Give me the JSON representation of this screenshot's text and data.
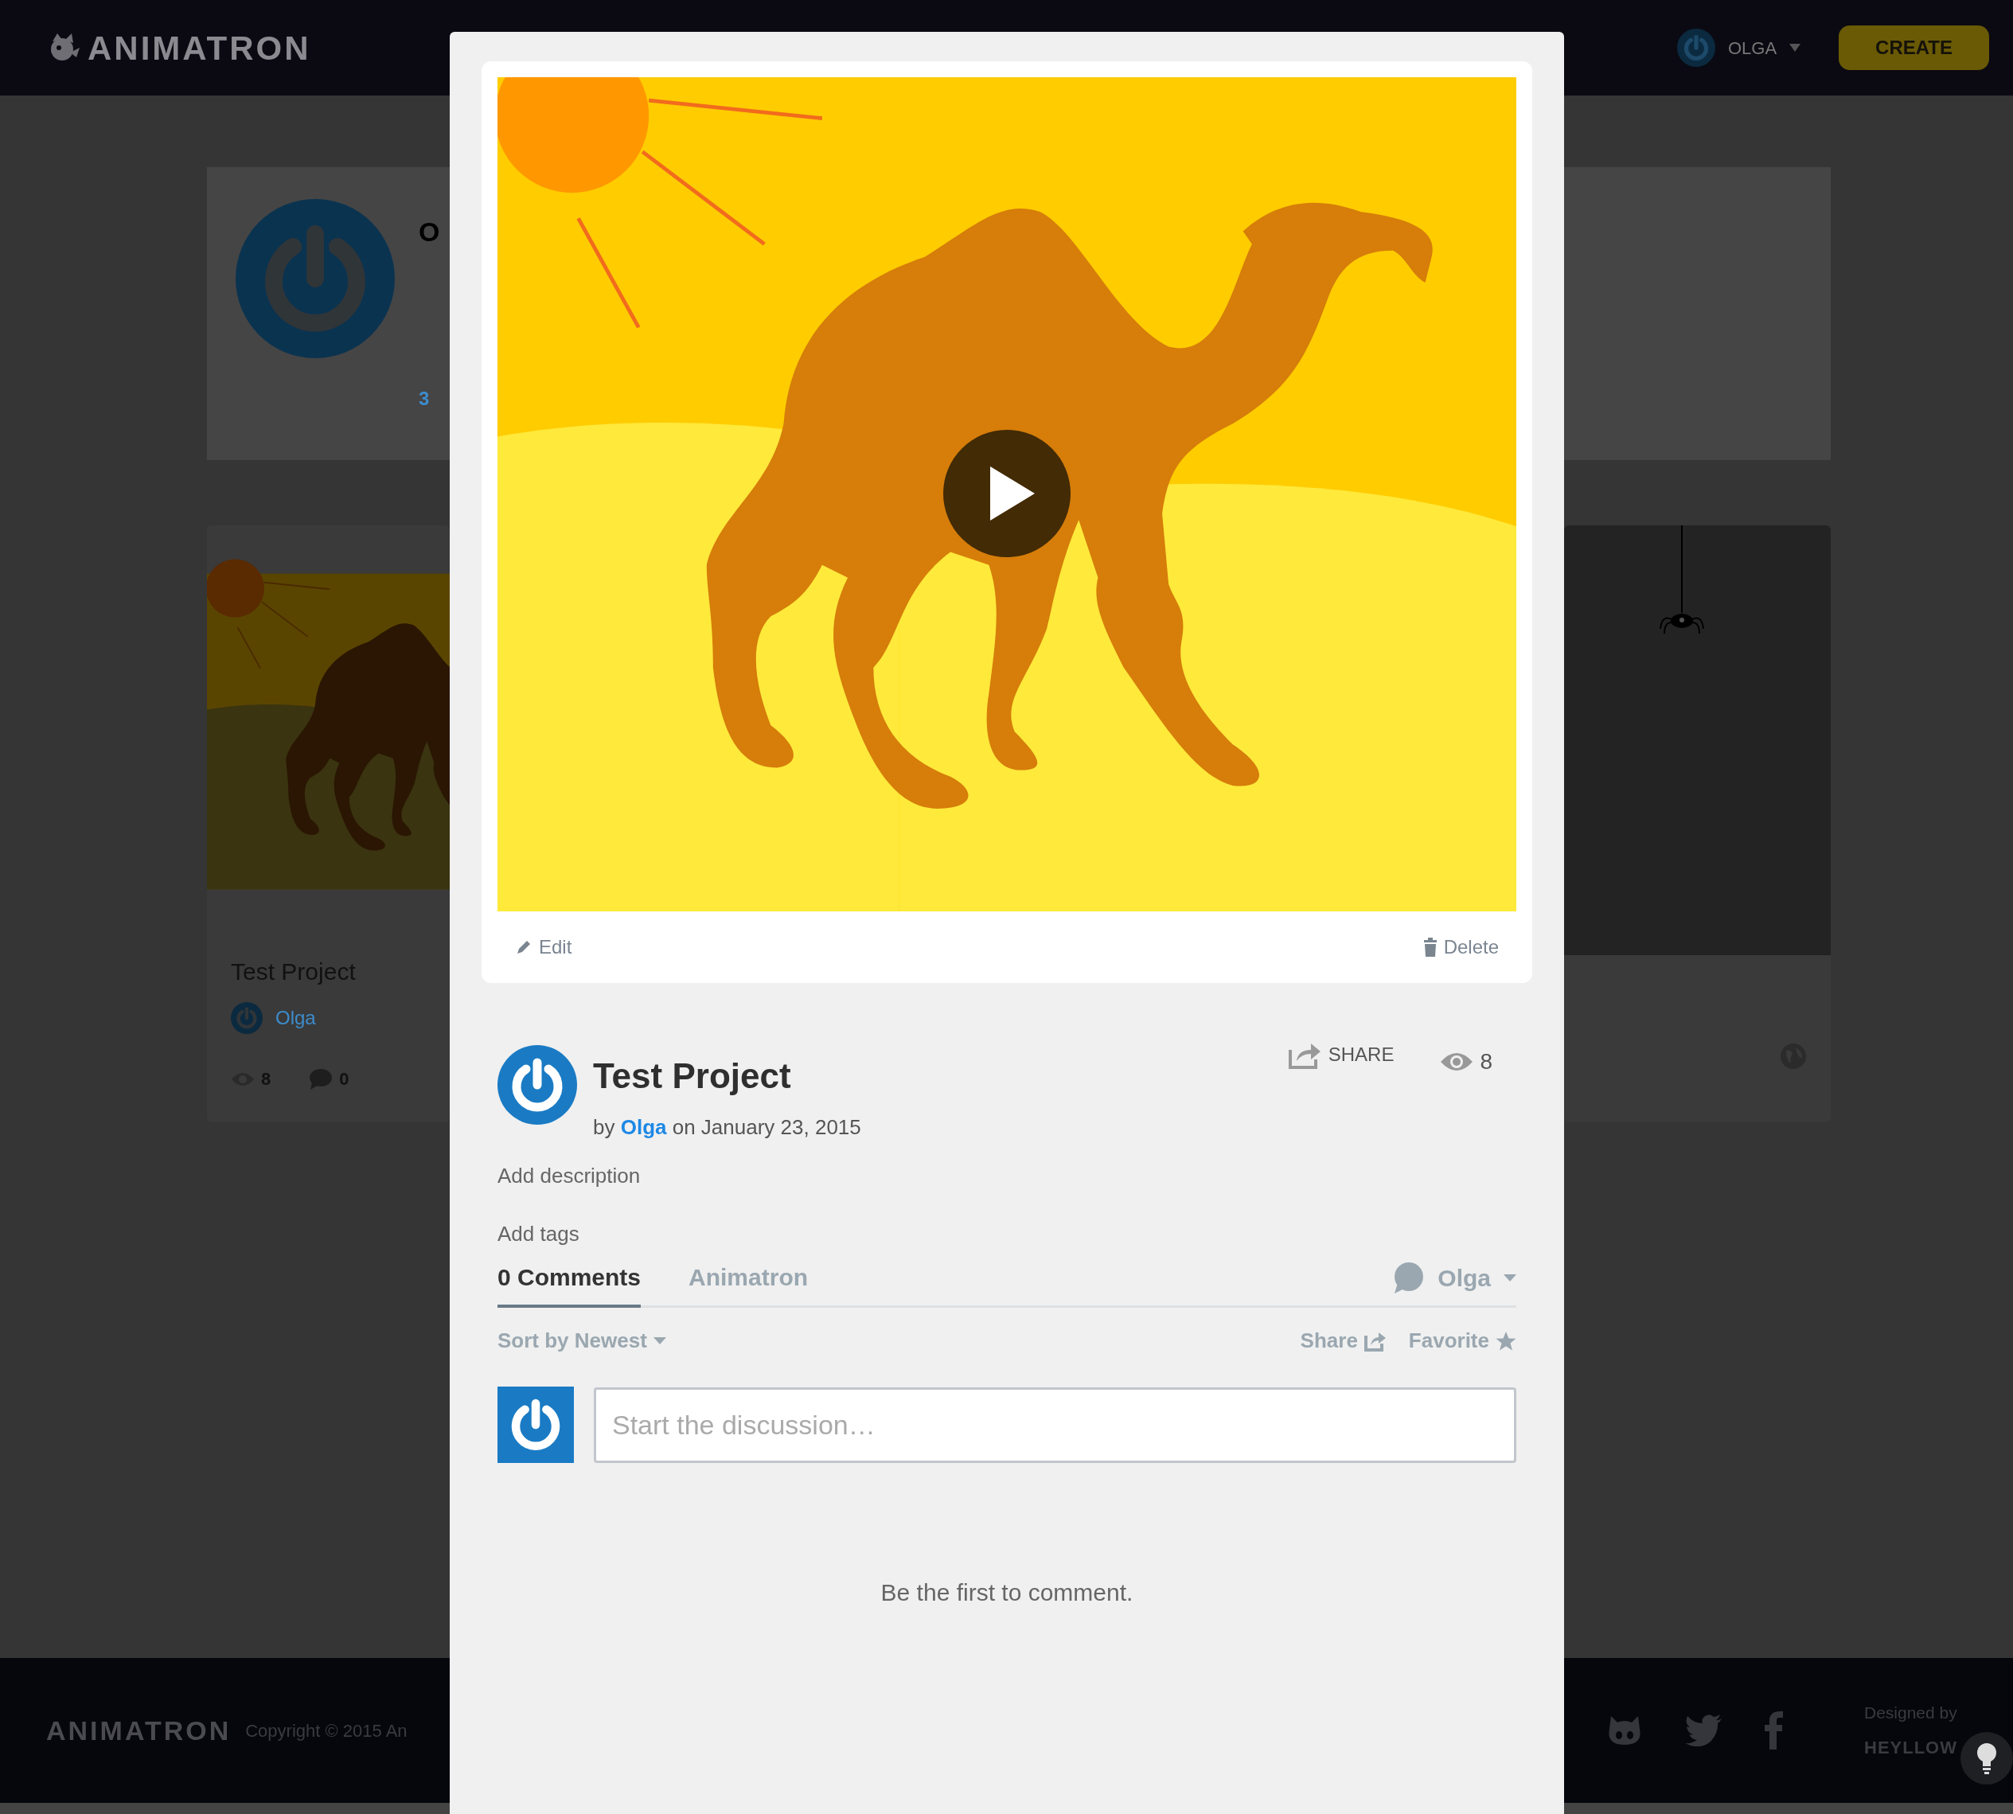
{
  "header": {
    "logo": "ANIMATRON",
    "user": "OLGA",
    "create_button": "CREATE"
  },
  "profile": {
    "name": "O",
    "stat": "3"
  },
  "projects": [
    {
      "kind": "project",
      "title": "Test Project",
      "author": "Olga",
      "views": "8",
      "comments": "0"
    },
    {
      "kind": "spider"
    }
  ],
  "modal": {
    "actions": [
      {
        "kind": "edit",
        "label": "Edit"
      },
      {
        "kind": "delete",
        "label": "Delete"
      }
    ],
    "title": "Test Project",
    "by": "by",
    "author": "Olga",
    "date": "on January 23, 2015",
    "share": "SHARE",
    "views": "8",
    "description_placeholder": "Add description",
    "tags_placeholder": "Add tags"
  },
  "comments": {
    "tabs": [
      {
        "label": "0 Comments",
        "selected": true
      },
      {
        "label": "Animatron",
        "selected": false
      }
    ],
    "user": "Olga",
    "sort": "Sort by Newest",
    "actions": [
      {
        "kind": "share",
        "label": "Share"
      },
      {
        "kind": "favorite",
        "label": "Favorite"
      }
    ],
    "placeholder": "Start the discussion…",
    "empty": "Be the first to comment."
  },
  "footer": {
    "logo": "ANIMATRON",
    "copyright": "Copyright © 2015 An",
    "designed_by": "Designed by",
    "designer": "HEYLLOW"
  }
}
